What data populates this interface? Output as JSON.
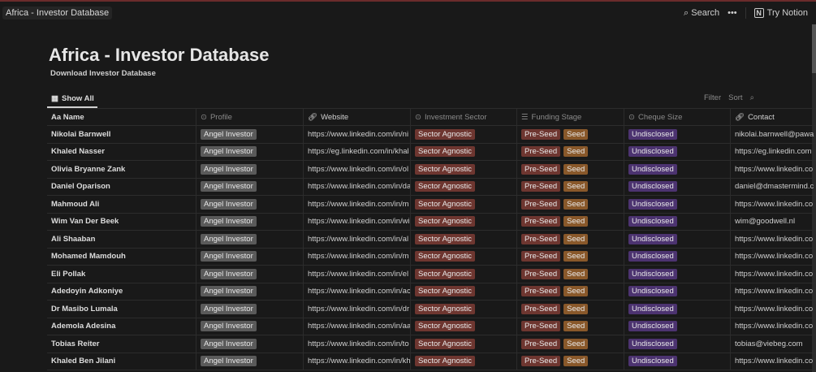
{
  "breadcrumb": "Africa - Investor Database",
  "topbar": {
    "search": "Search",
    "more": "•••",
    "try_notion": "Try Notion"
  },
  "title": "Africa - Investor Database",
  "description": "Download Investor Database",
  "view_tab": "Show All",
  "tools": {
    "filter": "Filter",
    "sort": "Sort"
  },
  "colors": {
    "profile": "#5a5a5a",
    "sector": "#6e3630",
    "preseed": "#6e3630",
    "seed": "#89582a",
    "cheque": "#4c3370"
  },
  "columns": [
    "Aa Name",
    "Profile",
    "Website",
    "Investment Sector",
    "Funding Stage",
    "Cheque Size",
    "Contact"
  ],
  "column_icons": [
    "text-icon",
    "select-icon",
    "link-icon",
    "select-icon",
    "list-icon",
    "select-icon",
    "link-icon"
  ],
  "rows": [
    {
      "name": "Nikolai Barnwell",
      "profile": "Angel Investor",
      "website": "https://www.linkedin.com/in/ni",
      "sector": "Sector Agnostic",
      "stages": [
        "Pre-Seed",
        "Seed"
      ],
      "cheque": "Undisclosed",
      "contact": "nikolai.barnwell@pawa"
    },
    {
      "name": "Khaled Nasser",
      "profile": "Angel Investor",
      "website": "https://eg.linkedin.com/in/khal",
      "sector": "Sector Agnostic",
      "stages": [
        "Pre-Seed",
        "Seed"
      ],
      "cheque": "Undisclosed",
      "contact": "https://eg.linkedin.com"
    },
    {
      "name": "Olivia Bryanne Zank",
      "profile": "Angel Investor",
      "website": "https://www.linkedin.com/in/ol",
      "sector": "Sector Agnostic",
      "stages": [
        "Pre-Seed",
        "Seed"
      ],
      "cheque": "Undisclosed",
      "contact": "https://www.linkedin.co"
    },
    {
      "name": "Daniel Oparison",
      "profile": "Angel Investor",
      "website": "https://www.linkedin.com/in/da",
      "sector": "Sector Agnostic",
      "stages": [
        "Pre-Seed",
        "Seed"
      ],
      "cheque": "Undisclosed",
      "contact": "daniel@dmastermind.c"
    },
    {
      "name": "Mahmoud Ali",
      "profile": "Angel Investor",
      "website": "https://www.linkedin.com/in/m",
      "sector": "Sector Agnostic",
      "stages": [
        "Pre-Seed",
        "Seed"
      ],
      "cheque": "Undisclosed",
      "contact": "https://www.linkedin.co"
    },
    {
      "name": "Wim Van Der Beek",
      "profile": "Angel Investor",
      "website": "https://www.linkedin.com/in/wi",
      "sector": "Sector Agnostic",
      "stages": [
        "Pre-Seed",
        "Seed"
      ],
      "cheque": "Undisclosed",
      "contact": "wim@goodwell.nl"
    },
    {
      "name": "Ali Shaaban",
      "profile": "Angel Investor",
      "website": "https://www.linkedin.com/in/al",
      "sector": "Sector Agnostic",
      "stages": [
        "Pre-Seed",
        "Seed"
      ],
      "cheque": "Undisclosed",
      "contact": "https://www.linkedin.co"
    },
    {
      "name": "Mohamed Mamdouh",
      "profile": "Angel Investor",
      "website": "https://www.linkedin.com/in/m",
      "sector": "Sector Agnostic",
      "stages": [
        "Pre-Seed",
        "Seed"
      ],
      "cheque": "Undisclosed",
      "contact": "https://www.linkedin.co"
    },
    {
      "name": "Eli Pollak",
      "profile": "Angel Investor",
      "website": "https://www.linkedin.com/in/el",
      "sector": "Sector Agnostic",
      "stages": [
        "Pre-Seed",
        "Seed"
      ],
      "cheque": "Undisclosed",
      "contact": "https://www.linkedin.co"
    },
    {
      "name": "Adedoyin Adkoniye",
      "profile": "Angel Investor",
      "website": "https://www.linkedin.com/in/ac",
      "sector": "Sector Agnostic",
      "stages": [
        "Pre-Seed",
        "Seed"
      ],
      "cheque": "Undisclosed",
      "contact": "https://www.linkedin.co"
    },
    {
      "name": "Dr Masibo Lumala",
      "profile": "Angel Investor",
      "website": "https://www.linkedin.com/in/dr",
      "sector": "Sector Agnostic",
      "stages": [
        "Pre-Seed",
        "Seed"
      ],
      "cheque": "Undisclosed",
      "contact": "https://www.linkedin.co"
    },
    {
      "name": "Ademola Adesina",
      "profile": "Angel Investor",
      "website": "https://www.linkedin.com/in/aa",
      "sector": "Sector Agnostic",
      "stages": [
        "Pre-Seed",
        "Seed"
      ],
      "cheque": "Undisclosed",
      "contact": "https://www.linkedin.co"
    },
    {
      "name": "Tobias Reiter",
      "profile": "Angel Investor",
      "website": "https://www.linkedin.com/in/to",
      "sector": "Sector Agnostic",
      "stages": [
        "Pre-Seed",
        "Seed"
      ],
      "cheque": "Undisclosed",
      "contact": "tobias@viebeg.com"
    },
    {
      "name": "Khaled Ben Jilani",
      "profile": "Angel Investor",
      "website": "https://www.linkedin.com/in/kh",
      "sector": "Sector Agnostic",
      "stages": [
        "Pre-Seed",
        "Seed"
      ],
      "cheque": "Undisclosed",
      "contact": "https://www.linkedin.co"
    }
  ]
}
